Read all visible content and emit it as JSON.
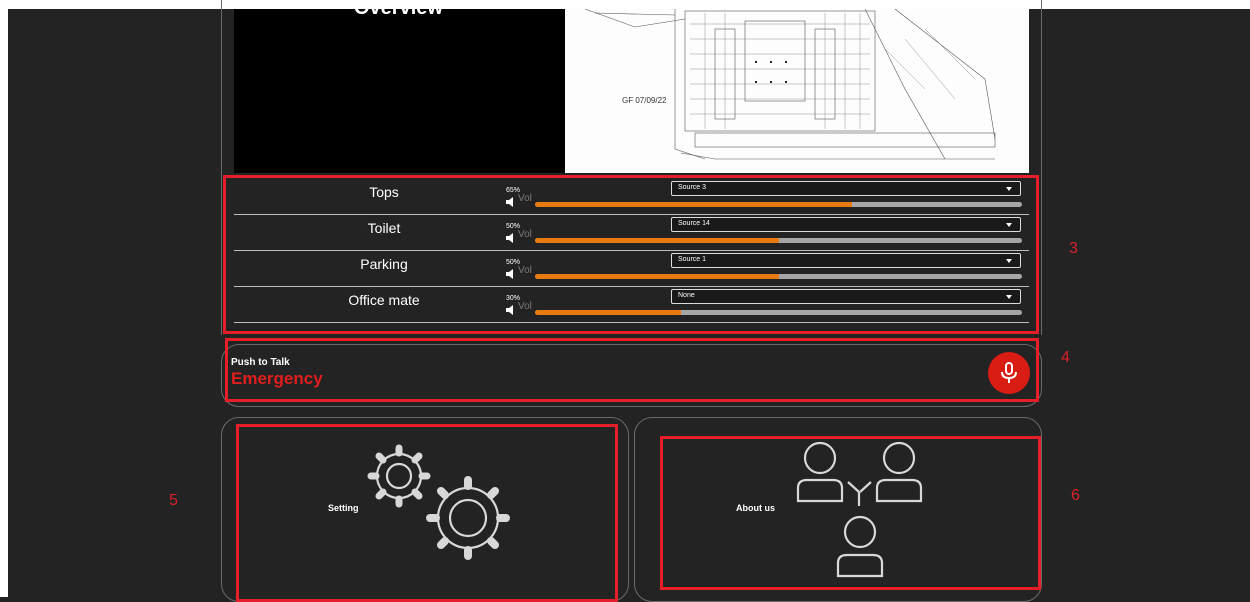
{
  "overview": {
    "title": "Overview",
    "plan_label": "GF 07/09/22"
  },
  "zones": [
    {
      "name": "Tops",
      "volume_label": "65%",
      "volume": 0.65,
      "vol_word": "Vol",
      "source": "Source 3"
    },
    {
      "name": "Toilet",
      "volume_label": "50%",
      "volume": 0.5,
      "vol_word": "Vol",
      "source": "Source 14"
    },
    {
      "name": "Parking",
      "volume_label": "50%",
      "volume": 0.5,
      "vol_word": "Vol",
      "source": "Source 1"
    },
    {
      "name": "Office mate",
      "volume_label": "30%",
      "volume": 0.3,
      "vol_word": "Vol",
      "source": "None"
    }
  ],
  "push_to_talk": {
    "label": "Push to Talk",
    "title": "Emergency",
    "icon": "microphone-icon"
  },
  "cards": {
    "setting": {
      "label": "Setting",
      "icon": "gears-icon"
    },
    "about": {
      "label": "About us",
      "icon": "team-icon"
    }
  },
  "annotations": {
    "n3": "3",
    "n4": "4",
    "n5": "5",
    "n6": "6"
  },
  "colors": {
    "accent_red": "#e61e2a",
    "volume_fill": "#e87a0f",
    "mic_button": "#d91c14",
    "background": "#232323"
  }
}
